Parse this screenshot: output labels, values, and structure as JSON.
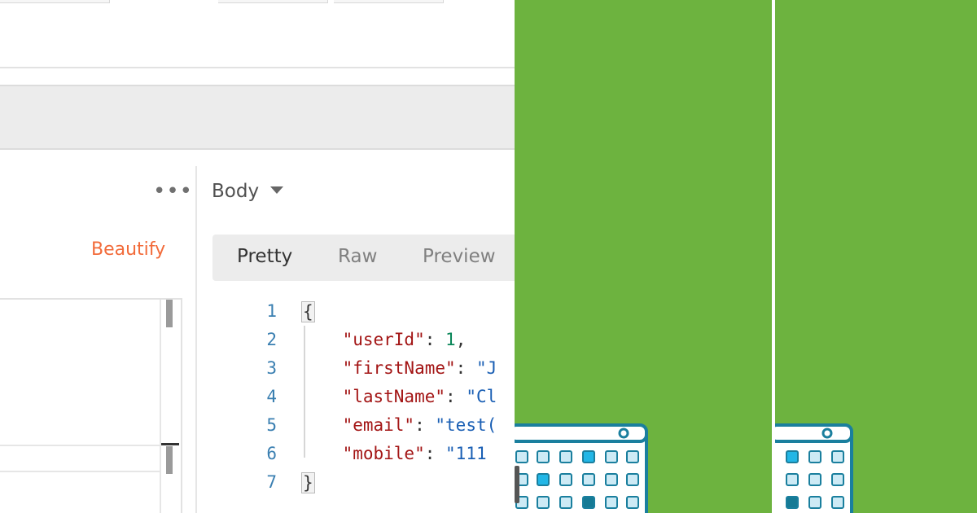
{
  "response": {
    "body_dropdown": "Body",
    "view_tabs": [
      "Pretty",
      "Raw",
      "Preview"
    ],
    "line_numbers": [
      "1",
      "2",
      "3",
      "4",
      "5",
      "6",
      "7"
    ],
    "code": {
      "open_brace": "{",
      "userId_key": "\"userId\"",
      "userId_value": "1",
      "firstName_key": "\"firstName\"",
      "firstName_value": "\"J",
      "lastName_key": "\"lastName\"",
      "lastName_value": "\"Cl",
      "email_key": "\"email\"",
      "email_value": "\"test(",
      "mobile_key": "\"mobile\"",
      "mobile_value": "\"111",
      "close_brace": "}"
    }
  },
  "request": {
    "beautify_label": "Beautify",
    "more_label": "•••"
  },
  "colors": {
    "accent_orange": "#f26b3a",
    "graphic_green": "#6db33f",
    "calendar_teal": "#1a7f9e"
  },
  "icons": {
    "more": "more-horizontal-icon",
    "dropdown": "caret-down-icon",
    "calendar": "calendar-icon"
  }
}
